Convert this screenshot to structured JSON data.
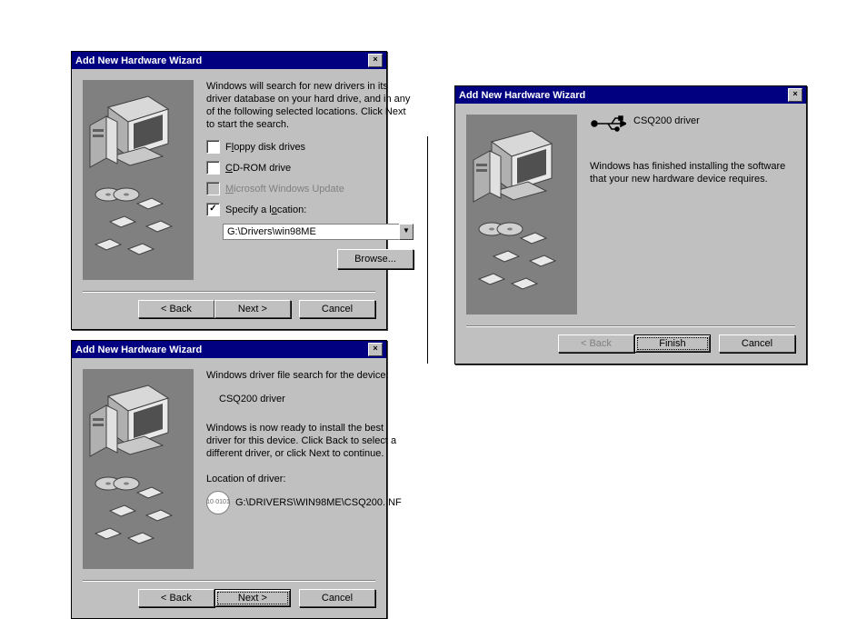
{
  "dialog1": {
    "title": "Add New Hardware Wizard",
    "intro": "Windows will search for new drivers in its driver database on your hard drive, and in any of the following selected locations. Click Next to start the search.",
    "cb_floppy": {
      "label_pre": "F",
      "label_u": "l",
      "label_post": "oppy disk drives",
      "checked": false,
      "enabled": true
    },
    "cb_cdrom": {
      "label_pre": "",
      "label_u": "C",
      "label_post": "D-ROM drive",
      "checked": false,
      "enabled": true
    },
    "cb_wu": {
      "label_pre": "",
      "label_u": "M",
      "label_post": "icrosoft Windows Update",
      "checked": false,
      "enabled": false
    },
    "cb_loc": {
      "label_pre": "Specify a l",
      "label_u": "o",
      "label_post": "cation:",
      "checked": true,
      "enabled": true
    },
    "path": "G:\\Drivers\\win98ME",
    "browse": "Browse...",
    "back": "< Back",
    "next": "Next >",
    "cancel": "Cancel"
  },
  "dialog2": {
    "title": "Add New Hardware Wizard",
    "line1": "Windows driver file search for the device:",
    "device": "CSQ200 driver",
    "line2": "Windows is now ready to install the best driver for this device. Click Back to select a different driver, or click Next to continue.",
    "loc_label": "Location of driver:",
    "loc_path": "G:\\DRIVERS\\WIN98ME\\CSQ200.INF",
    "back": "< Back",
    "next": "Next >",
    "cancel": "Cancel"
  },
  "dialog3": {
    "title": "Add New Hardware Wizard",
    "device": "CSQ200 driver",
    "msg": "Windows has finished installing the software that your new hardware device requires.",
    "back": "< Back",
    "finish": "Finish",
    "cancel": "Cancel"
  }
}
